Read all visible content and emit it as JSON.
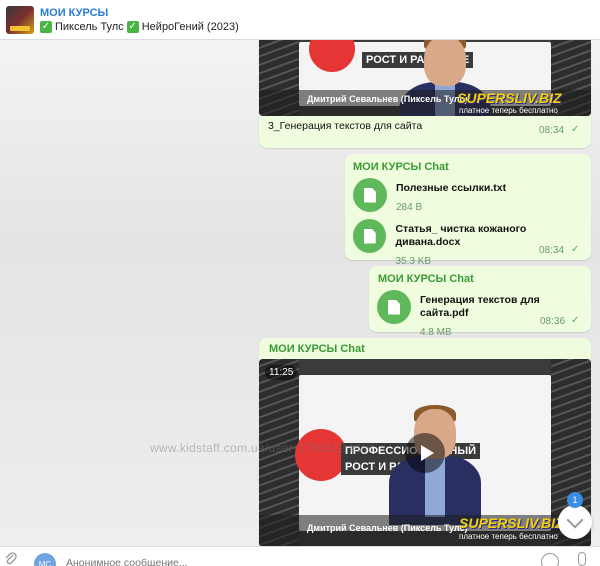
{
  "header": {
    "title": "МОИ КУРСЫ",
    "subtitle_part1": "Пиксель Тулс",
    "subtitle_part2": "НейроГений (2023)",
    "check": "✓"
  },
  "messages": {
    "video1": {
      "slogan_line1": "РОСТ И РАЗВИТИЕ",
      "speaker": "Дмитрий Севальнев (Пиксель Тулс)",
      "brand": "SUPERSLIV.BIZ",
      "brand_sub": "платное теперь бесплатно",
      "caption": "3_Генерация текстов для сайта",
      "time": "08:34"
    },
    "files1": {
      "sender": "МОИ КУРСЫ Chat",
      "items": [
        {
          "name": "Полезные ссылки.txt",
          "size": "284 B"
        },
        {
          "name": "Статья_ чистка кожаного дивана.docx",
          "size": "35.3 KB"
        }
      ],
      "time": "08:34"
    },
    "files2": {
      "sender": "МОИ КУРСЫ Chat",
      "items": [
        {
          "name": "Генерация текстов для сайта.pdf",
          "size": "4.8 MB"
        }
      ],
      "time": "08:36"
    },
    "video2": {
      "sender": "МОИ КУРСЫ Chat",
      "duration": "11:25",
      "slogan_line1": "ПРОФЕССИОНАЛЬНЫЙ",
      "slogan_line2": "РОСТ И РАЗВИТИЕ",
      "speaker": "Дмитрий Севальнев (Пиксель Тулс)",
      "brand": "SUPERSLIV.BIZ",
      "brand_sub": "платное теперь бесплатно"
    }
  },
  "scroll": {
    "unread_count": "1"
  },
  "watermark": "www.kidstaff.com.ua/user-1756512.html",
  "composer": {
    "avatar_initials": "MC",
    "placeholder": "Анонимное сообщение..."
  },
  "colors": {
    "bubble": "#effdde",
    "sender": "#3a9a37",
    "accent": "#2a7bd6"
  }
}
